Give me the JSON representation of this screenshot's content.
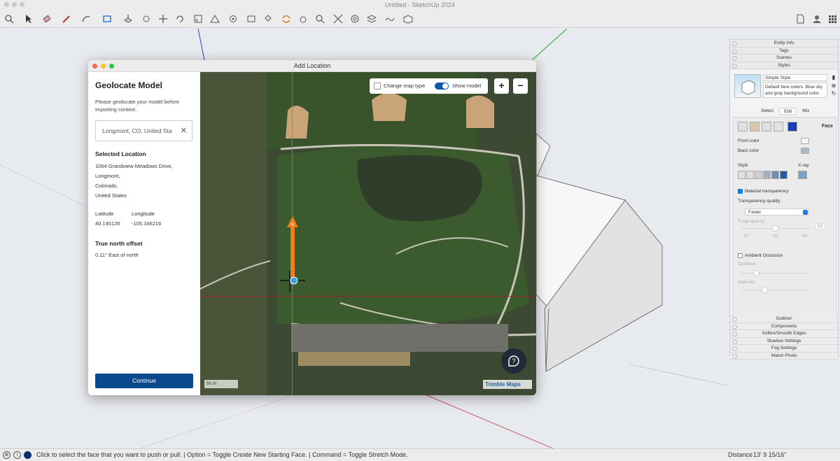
{
  "window": {
    "title": "Untitled - SketchUp 2024"
  },
  "dialog": {
    "title": "Add Location",
    "heading": "Geolocate Model",
    "instructions": "Please geolocate your model before importing context.",
    "search_value": "Longmont, CO, United Sta",
    "selected_location_label": "Selected Location",
    "address": [
      "1064 Grandview Meadows Drive,",
      "Longmont,",
      "Colorado,",
      "United States"
    ],
    "latitude_label": "Latitude",
    "longitude_label": "Longitude",
    "latitude": "40.145126",
    "longitude": "-105.166216",
    "north_offset_label": "True north offset",
    "north_offset": "0.11° East of north",
    "continue_label": "Continue",
    "map": {
      "change_map_type": "Change map type",
      "show_model": "Show model",
      "show_model_on": true,
      "zoom_in": "+",
      "zoom_out": "−",
      "scale": "50 m",
      "brand": "Trimble Maps",
      "north_marker": "N"
    }
  },
  "tray": {
    "top_sections": [
      "Entity Info",
      "Tags",
      "Scenes",
      "Styles"
    ],
    "style_name": "Simple Style",
    "style_desc": "Default face colors. Blue sky and gray background color.",
    "tabs": [
      "Select",
      "Edit",
      "Mix"
    ],
    "active_tab": "Edit",
    "face_label": "Face",
    "front_color_label": "Front color",
    "back_color_label": "Back color",
    "front_color": "#f7f7f7",
    "back_color": "#a9bac9",
    "style_label": "Style",
    "xray_label": "X-ray",
    "material_transparency_label": "Material transparency",
    "material_transparency": true,
    "transparency_quality_label": "Transparency quality:",
    "transparency_quality": "Faster",
    "xray_opacity_label": "X-ray opacity:",
    "xray_opacity_value": "50",
    "xray_ticks": [
      "20",
      "50",
      "80"
    ],
    "ambient_occlusion_label": "Ambient Occlusion",
    "ambient_occlusion": false,
    "distance_label": "Distance:",
    "intensity_label": "Intensity:",
    "bottom_sections": [
      "Outliner",
      "Components",
      "Soften/Smooth Edges",
      "Shadow Settings",
      "Fog Settings",
      "Match Photo"
    ]
  },
  "statusbar": {
    "message": "Click to select the face that you want to push or pull. | Option = Toggle Create New Starting Face. | Command = Toggle Stretch Mode.",
    "distance_label": "Distance",
    "distance_value": "13' 9 15/16\""
  }
}
